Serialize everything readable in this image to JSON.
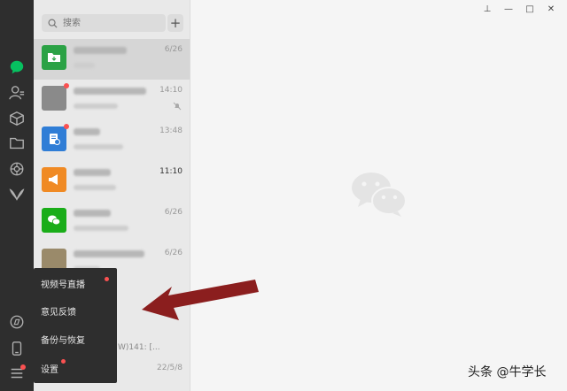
{
  "search": {
    "placeholder": "搜索"
  },
  "plus_label": "+",
  "chats": [
    {
      "time": "6/26",
      "avatar_color": "#2ba245"
    },
    {
      "time": "14:10",
      "avatar_color": "#8a8a8a"
    },
    {
      "time": "13:48",
      "avatar_color": "#2f7dd6"
    },
    {
      "time": "11:10",
      "avatar_color": "#f08a24"
    },
    {
      "time": "6/26",
      "avatar_color": "#1aad19"
    },
    {
      "time": "6/26",
      "avatar_color": "#9a8a6a"
    },
    {
      "time": "22/5/8",
      "avatar_color": "#aaaaaa"
    }
  ],
  "partial_message": "W)141: [...",
  "popup_menu": {
    "items": [
      {
        "label": "视频号直播"
      },
      {
        "label": "意见反馈"
      },
      {
        "label": "备份与恢复"
      },
      {
        "label": "设置"
      }
    ]
  },
  "window_controls": {
    "pin": "⊥",
    "minimize": "—",
    "maximize": "□",
    "close": "✕"
  },
  "watermark": "头条 @牛学长",
  "colors": {
    "sidebar": "#2e2e2e",
    "accent_green": "#07c160",
    "badge_red": "#fa5151"
  }
}
